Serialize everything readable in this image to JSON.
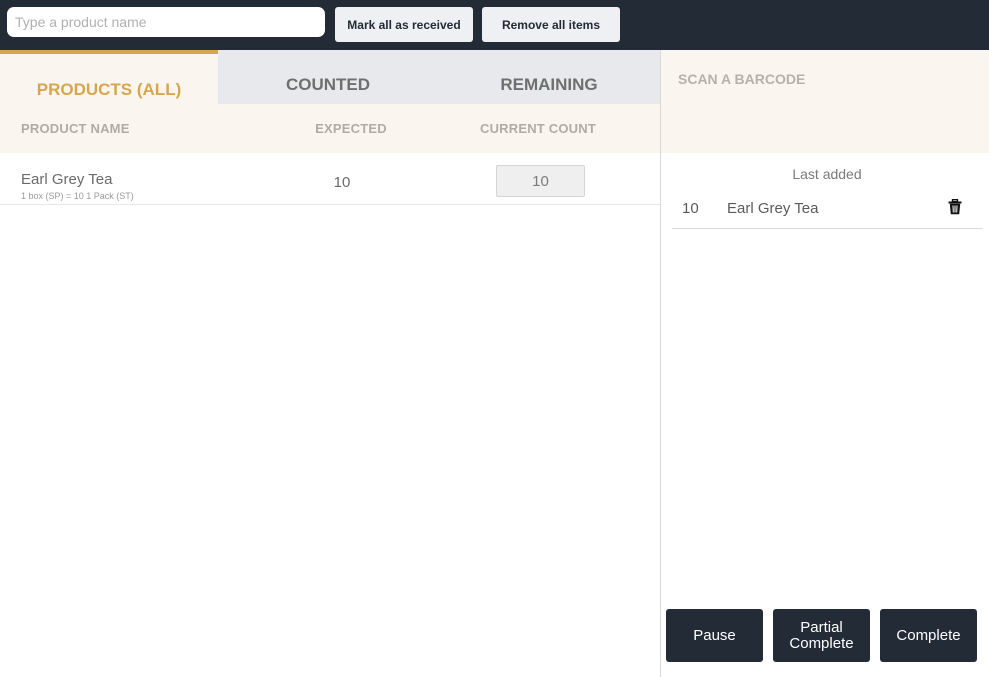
{
  "search": {
    "placeholder": "Type a product name",
    "value": ""
  },
  "toolbar": {
    "mark_all_label": "Mark all as received",
    "remove_all_label": "Remove all items"
  },
  "tabs": [
    {
      "label": "PRODUCTS (ALL)",
      "active": true
    },
    {
      "label": "COUNTED",
      "active": false
    },
    {
      "label": "REMAINING",
      "active": false
    }
  ],
  "table": {
    "headers": {
      "name": "PRODUCT NAME",
      "expected": "EXPECTED",
      "current": "CURRENT COUNT"
    },
    "rows": [
      {
        "name": "Earl Grey Tea",
        "sub": "1 box (SP) = 10 1 Pack (ST)",
        "expected": "10",
        "current": "10"
      }
    ]
  },
  "scan": {
    "label": "SCAN A BARCODE"
  },
  "last_added": {
    "title": "Last added",
    "items": [
      {
        "qty": "10",
        "name": "Earl Grey Tea",
        "icon": "trash-icon"
      }
    ]
  },
  "actions": {
    "pause": "Pause",
    "partial": "Partial Complete",
    "complete": "Complete"
  },
  "colors": {
    "topbar": "#232b36",
    "accent": "#d6a64f",
    "header_bg": "#faf6ef",
    "tab_bg": "#e8e9ec"
  }
}
